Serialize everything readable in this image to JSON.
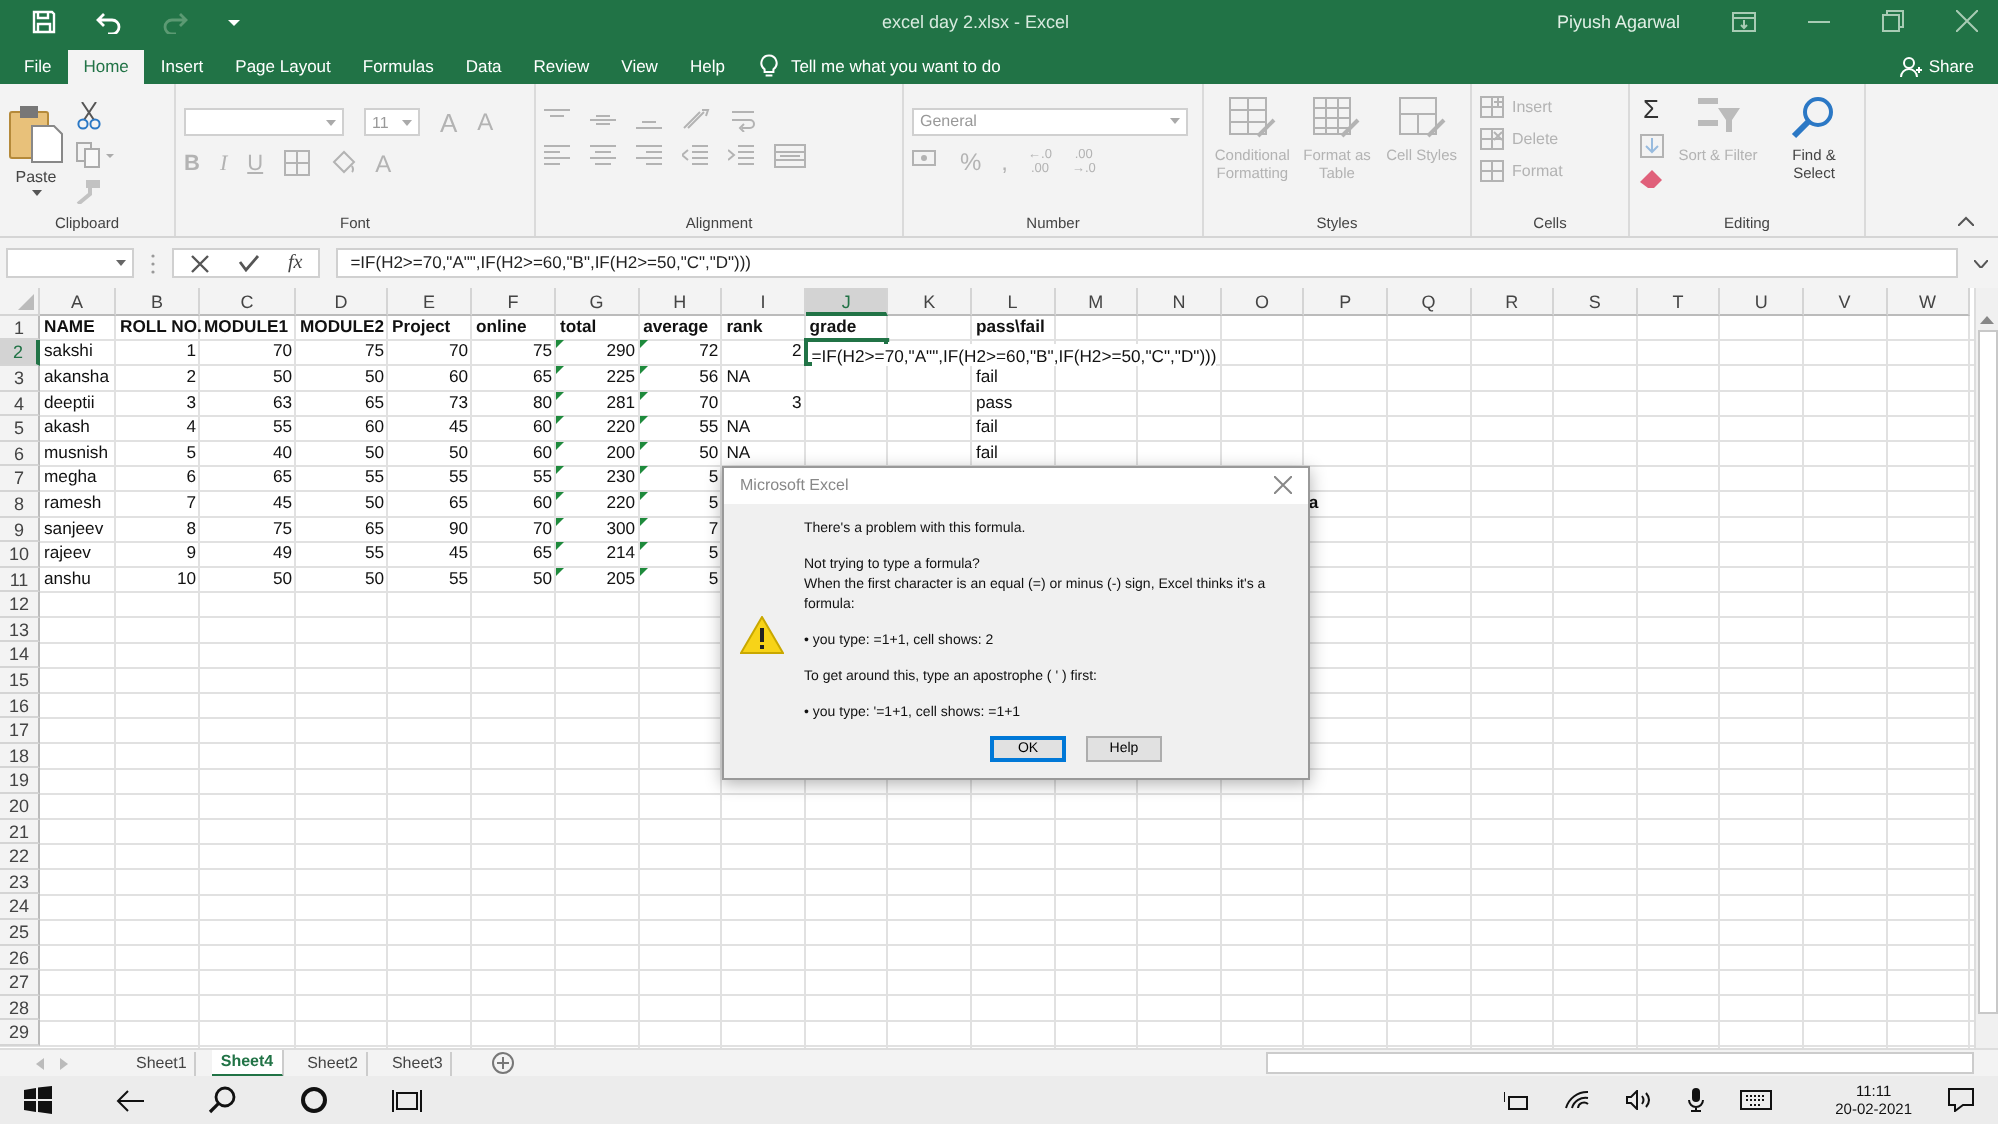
{
  "title_bar": {
    "title": "excel day 2.xlsx  -  Excel",
    "user": "Piyush Agarwal"
  },
  "quick_access": [
    {
      "kind": "save",
      "disabled": false
    },
    {
      "kind": "undo",
      "disabled": false
    },
    {
      "kind": "redo",
      "disabled": true
    },
    {
      "kind": "customize",
      "disabled": false
    }
  ],
  "tabs": [
    {
      "label": "File",
      "selected": false
    },
    {
      "label": "Home",
      "selected": true
    },
    {
      "label": "Insert",
      "selected": false
    },
    {
      "label": "Page Layout",
      "selected": false
    },
    {
      "label": "Formulas",
      "selected": false
    },
    {
      "label": "Data",
      "selected": false
    },
    {
      "label": "Review",
      "selected": false
    },
    {
      "label": "View",
      "selected": false
    },
    {
      "label": "Help",
      "selected": false
    }
  ],
  "tell_me": {
    "placeholder": "Tell me what you want to do"
  },
  "share": "Share",
  "ribbon": {
    "clipboard": {
      "label": "Clipboard",
      "paste": "Paste",
      "tools": [
        {
          "kind": "cut",
          "disabled": false
        },
        {
          "kind": "copy",
          "disabled": true
        },
        {
          "kind": "painter",
          "disabled": true
        }
      ]
    },
    "font": {
      "label": "Font",
      "disabled": true,
      "size": "11",
      "grow": "A",
      "shrink": "A",
      "styles": [
        "B",
        "I",
        "U"
      ],
      "font_color_label": "A"
    },
    "alignment": {
      "label": "Alignment",
      "disabled": true
    },
    "number": {
      "label": "Number",
      "disabled": true,
      "format": "General",
      "symbols": [
        "%",
        ","
      ],
      "decimals": [
        {
          "top": "←.0",
          "bottom": ".00"
        },
        {
          "top": ".00",
          "bottom": "→.0"
        }
      ]
    },
    "styles": {
      "label": "Styles",
      "disabled": true,
      "items": [
        {
          "kind": "conditional",
          "label": "Conditional Formatting"
        },
        {
          "kind": "table",
          "label": "Format as Table"
        },
        {
          "kind": "cell",
          "label": "Cell Styles"
        }
      ]
    },
    "cells": {
      "label": "Cells",
      "disabled": true,
      "items": [
        {
          "kind": "insert",
          "label": "Insert"
        },
        {
          "kind": "delete",
          "label": "Delete"
        },
        {
          "kind": "format",
          "label": "Format"
        }
      ]
    },
    "editing": {
      "label": "Editing",
      "autosum": "Σ",
      "tools": [
        {
          "kind": "fill",
          "disabled": true
        },
        {
          "kind": "clear",
          "disabled": false
        }
      ],
      "sort": {
        "label": "Sort & Filter",
        "disabled": true
      },
      "find": {
        "label": "Find & Select",
        "disabled": false
      }
    }
  },
  "formula_bar": {
    "function_label": "fx",
    "formula": "=IF(H2>=70,\"A\"\",IF(H2>=60,\"B\",IF(H2>=50,\"C\",\"D\")))"
  },
  "sheet": {
    "columns": [
      "A",
      "B",
      "C",
      "D",
      "E",
      "F",
      "G",
      "H",
      "I",
      "J",
      "K",
      "L",
      "M",
      "N",
      "O",
      "P",
      "Q",
      "R",
      "S",
      "T",
      "U",
      "V",
      "W"
    ],
    "rows": [
      {
        "number": "1",
        "cells": [
          {
            "text": "NAME",
            "bold": true
          },
          {
            "text": "ROLL NO.",
            "bold": true
          },
          {
            "text": "MODULE1",
            "bold": true
          },
          {
            "text": "MODULE2",
            "bold": true
          },
          {
            "text": "Project",
            "bold": true
          },
          {
            "text": "online",
            "bold": true
          },
          {
            "text": "total",
            "bold": true
          },
          {
            "text": "average",
            "bold": true
          },
          {
            "text": "rank",
            "bold": true
          },
          {
            "text": "grade",
            "bold": true
          },
          null,
          {
            "text": "pass\\fail",
            "bold": true
          }
        ]
      },
      {
        "number": "2",
        "cells": [
          {
            "text": "sakshi"
          },
          {
            "text": "1",
            "right_aligned": true
          },
          {
            "text": "70",
            "right_aligned": true
          },
          {
            "text": "75",
            "right_aligned": true
          },
          {
            "text": "70",
            "right_aligned": true
          },
          {
            "text": "75",
            "right_aligned": true
          },
          {
            "text": "290",
            "right_aligned": true,
            "flag": true
          },
          {
            "text": "72",
            "right_aligned": true,
            "flag": true
          },
          {
            "text": "2",
            "right_aligned": true
          },
          {
            "text": "=IF(H2>=70,\"A\"\",IF(H2>=60,\"B\",IF(H2>=50,\"C\",\"D\")))",
            "active": true
          }
        ]
      },
      {
        "number": "3",
        "cells": [
          {
            "text": "akansha"
          },
          {
            "text": "2",
            "right_aligned": true
          },
          {
            "text": "50",
            "right_aligned": true
          },
          {
            "text": "50",
            "right_aligned": true
          },
          {
            "text": "60",
            "right_aligned": true
          },
          {
            "text": "65",
            "right_aligned": true
          },
          {
            "text": "225",
            "right_aligned": true,
            "flag": true
          },
          {
            "text": "56",
            "right_aligned": true,
            "flag": true
          },
          {
            "text": "NA"
          },
          null,
          null,
          {
            "text": "fail"
          }
        ]
      },
      {
        "number": "4",
        "cells": [
          {
            "text": "deeptii"
          },
          {
            "text": "3",
            "right_aligned": true
          },
          {
            "text": "63",
            "right_aligned": true
          },
          {
            "text": "65",
            "right_aligned": true
          },
          {
            "text": "73",
            "right_aligned": true
          },
          {
            "text": "80",
            "right_aligned": true
          },
          {
            "text": "281",
            "right_aligned": true,
            "flag": true
          },
          {
            "text": "70",
            "right_aligned": true,
            "flag": true
          },
          {
            "text": "3",
            "right_aligned": true
          },
          null,
          null,
          {
            "text": "pass"
          }
        ]
      },
      {
        "number": "5",
        "cells": [
          {
            "text": "akash"
          },
          {
            "text": "4",
            "right_aligned": true
          },
          {
            "text": "55",
            "right_aligned": true
          },
          {
            "text": "60",
            "right_aligned": true
          },
          {
            "text": "45",
            "right_aligned": true
          },
          {
            "text": "60",
            "right_aligned": true
          },
          {
            "text": "220",
            "right_aligned": true,
            "flag": true
          },
          {
            "text": "55",
            "right_aligned": true,
            "flag": true
          },
          {
            "text": "NA"
          },
          null,
          null,
          {
            "text": "fail"
          }
        ]
      },
      {
        "number": "6",
        "cells": [
          {
            "text": "musnish"
          },
          {
            "text": "5",
            "right_aligned": true
          },
          {
            "text": "40",
            "right_aligned": true
          },
          {
            "text": "50",
            "right_aligned": true
          },
          {
            "text": "50",
            "right_aligned": true
          },
          {
            "text": "60",
            "right_aligned": true
          },
          {
            "text": "200",
            "right_aligned": true,
            "flag": true
          },
          {
            "text": "50",
            "right_aligned": true,
            "flag": true
          },
          {
            "text": "NA"
          },
          null,
          null,
          {
            "text": "fail"
          }
        ]
      },
      {
        "number": "7",
        "cells": [
          {
            "text": "megha"
          },
          {
            "text": "6",
            "right_aligned": true
          },
          {
            "text": "65",
            "right_aligned": true
          },
          {
            "text": "55",
            "right_aligned": true
          },
          {
            "text": "55",
            "right_aligned": true
          },
          {
            "text": "55",
            "right_aligned": true
          },
          {
            "text": "230",
            "right_aligned": true,
            "flag": true
          },
          {
            "text": "5",
            "right_aligned": true,
            "flag": true
          }
        ]
      },
      {
        "number": "8",
        "cells": [
          {
            "text": "ramesh"
          },
          {
            "text": "7",
            "right_aligned": true
          },
          {
            "text": "45",
            "right_aligned": true
          },
          {
            "text": "50",
            "right_aligned": true
          },
          {
            "text": "65",
            "right_aligned": true
          },
          {
            "text": "60",
            "right_aligned": true
          },
          {
            "text": "220",
            "right_aligned": true,
            "flag": true
          },
          {
            "text": "5",
            "right_aligned": true,
            "flag": true
          },
          null,
          null,
          null,
          null,
          null,
          null,
          null,
          {
            "text": "a",
            "bold": true
          }
        ]
      },
      {
        "number": "9",
        "cells": [
          {
            "text": "sanjeev"
          },
          {
            "text": "8",
            "right_aligned": true
          },
          {
            "text": "75",
            "right_aligned": true
          },
          {
            "text": "65",
            "right_aligned": true
          },
          {
            "text": "90",
            "right_aligned": true
          },
          {
            "text": "70",
            "right_aligned": true
          },
          {
            "text": "300",
            "right_aligned": true,
            "flag": true
          },
          {
            "text": "7",
            "right_aligned": true,
            "flag": true
          }
        ]
      },
      {
        "number": "10",
        "cells": [
          {
            "text": "rajeev"
          },
          {
            "text": "9",
            "right_aligned": true
          },
          {
            "text": "49",
            "right_aligned": true
          },
          {
            "text": "55",
            "right_aligned": true
          },
          {
            "text": "45",
            "right_aligned": true
          },
          {
            "text": "65",
            "right_aligned": true
          },
          {
            "text": "214",
            "right_aligned": true,
            "flag": true
          },
          {
            "text": "5",
            "right_aligned": true,
            "flag": true
          }
        ]
      },
      {
        "number": "11",
        "cells": [
          {
            "text": "anshu"
          },
          {
            "text": "10",
            "right_aligned": true
          },
          {
            "text": "50",
            "right_aligned": true
          },
          {
            "text": "50",
            "right_aligned": true
          },
          {
            "text": "55",
            "right_aligned": true
          },
          {
            "text": "50",
            "right_aligned": true
          },
          {
            "text": "205",
            "right_aligned": true,
            "flag": true
          },
          {
            "text": "5",
            "right_aligned": true,
            "flag": true
          }
        ]
      },
      {
        "number": "12"
      },
      {
        "number": "13"
      },
      {
        "number": "14"
      },
      {
        "number": "15"
      },
      {
        "number": "16"
      },
      {
        "number": "17"
      },
      {
        "number": "18"
      },
      {
        "number": "19"
      },
      {
        "number": "20"
      },
      {
        "number": "21"
      },
      {
        "number": "22"
      },
      {
        "number": "23"
      },
      {
        "number": "24"
      },
      {
        "number": "25"
      },
      {
        "number": "26"
      },
      {
        "number": "27"
      },
      {
        "number": "28"
      },
      {
        "number": "29"
      }
    ]
  },
  "dialog": {
    "title": "Microsoft Excel",
    "lines": [
      "There's a problem with this formula.",
      "Not trying to type a formula?",
      "When the first character is an equal (=) or minus (-) sign, Excel thinks it's a formula:",
      "• you type:   =1+1, cell shows:   2",
      "To get around this, type an apostrophe ( ' ) first:",
      "• you type:   '=1+1, cell shows:   =1+1"
    ],
    "buttons": [
      {
        "label": "OK",
        "default": true
      },
      {
        "label": "Help",
        "default": false
      }
    ]
  },
  "sheet_tabs": [
    {
      "label": "Sheet1",
      "selected": false
    },
    {
      "label": "Sheet4",
      "selected": true
    },
    {
      "label": "Sheet2",
      "selected": false
    },
    {
      "label": "Sheet3",
      "selected": false
    }
  ],
  "taskbar": {
    "time": "11:11",
    "date": "20-02-2021"
  }
}
